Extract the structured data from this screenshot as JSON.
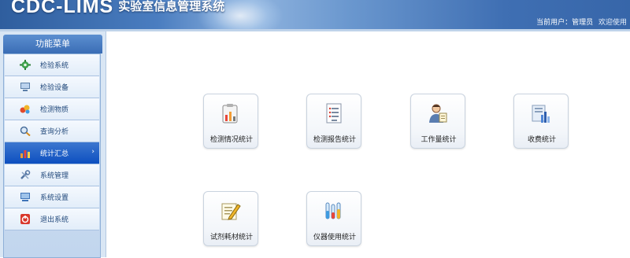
{
  "header": {
    "brand": "CDC-LIMS",
    "subtitle": "实验室信息管理系统",
    "user_label": "当前用户：管理员",
    "extra_label": "欢迎使用"
  },
  "sidebar": {
    "title": "功能菜单",
    "items": [
      {
        "label": "检验系统",
        "icon": "gear-icon"
      },
      {
        "label": "检验设备",
        "icon": "computer-icon"
      },
      {
        "label": "检测物质",
        "icon": "reagent-icon"
      },
      {
        "label": "查询分析",
        "icon": "search-icon"
      },
      {
        "label": "统计汇总",
        "icon": "bar-chart-icon"
      },
      {
        "label": "系统管理",
        "icon": "tools-icon"
      },
      {
        "label": "系统设置",
        "icon": "monitor-icon"
      },
      {
        "label": "退出系统",
        "icon": "power-icon"
      }
    ],
    "active_index": 4
  },
  "main": {
    "tiles": [
      {
        "label": "检测情况统计",
        "icon": "clipboard-bars-icon"
      },
      {
        "label": "检测报告统计",
        "icon": "document-list-icon"
      },
      {
        "label": "工作量统计",
        "icon": "worker-icon"
      },
      {
        "label": "收费统计",
        "icon": "report-chart-icon"
      },
      {
        "label": "试剂耗材统计",
        "icon": "pencil-note-icon"
      },
      {
        "label": "仪器使用统计",
        "icon": "test-tubes-icon"
      }
    ]
  },
  "colors": {
    "header": "#3f6fb3",
    "active_menu": "#0d4fc0",
    "sidebar": "#d9e6f4"
  }
}
